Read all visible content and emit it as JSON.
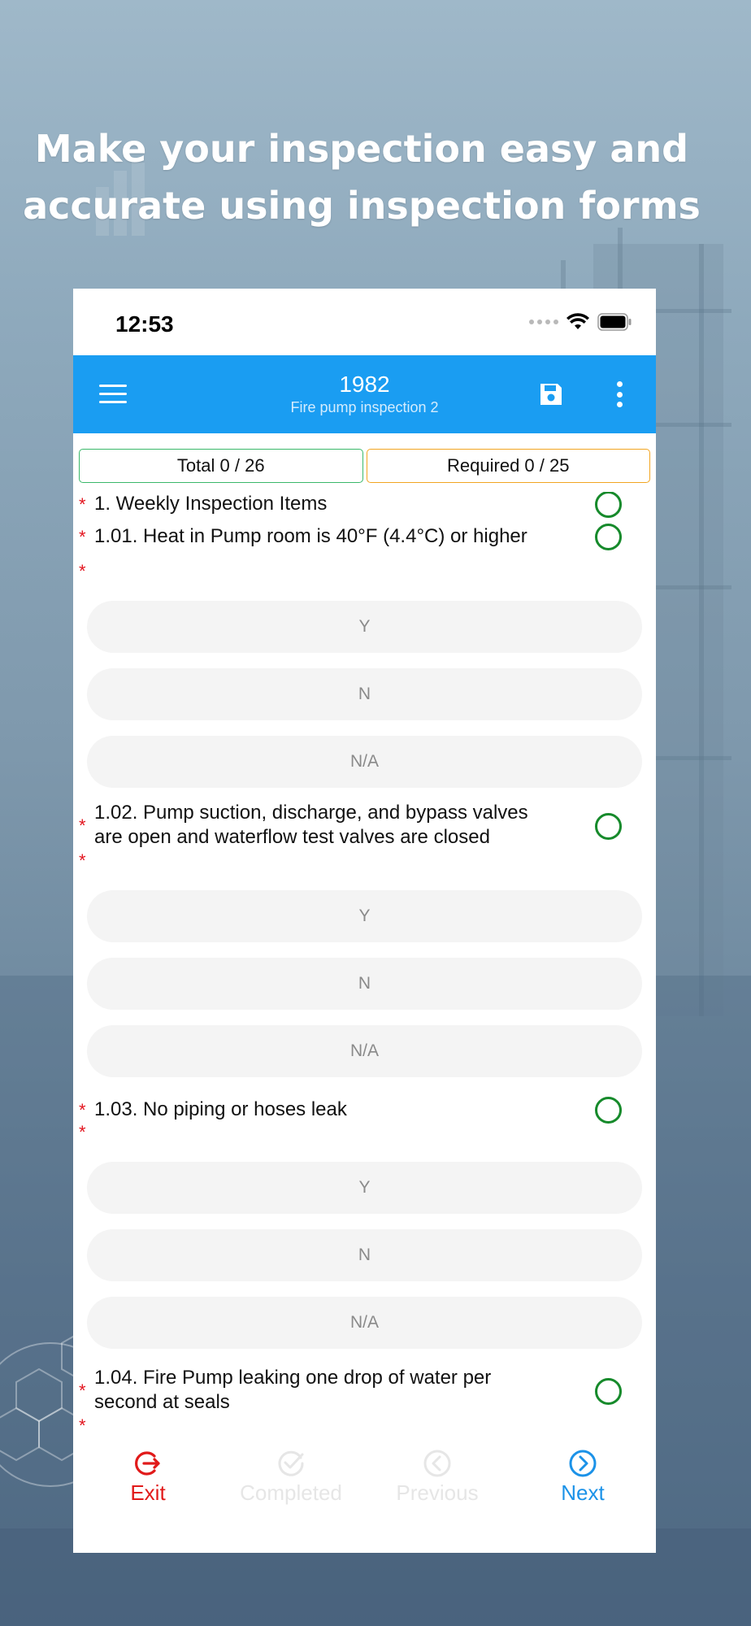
{
  "headline": {
    "line1": "Make your inspection easy and",
    "line2": "accurate using inspection forms"
  },
  "status_bar": {
    "time": "12:53"
  },
  "app_bar": {
    "title": "1982",
    "subtitle": "Fire pump inspection 2",
    "icons": [
      "menu-icon",
      "save-icon",
      "more-vertical-icon"
    ]
  },
  "counters": {
    "total_label": "Total  0 / 26",
    "required_label": "Required  0 / 25"
  },
  "questions": [
    {
      "text": "1. Weekly Inspection Items"
    },
    {
      "text": "1.01. Heat in Pump room is 40°F (4.4°C) or higher"
    },
    {
      "text_line1": "1.02. Pump suction, discharge, and bypass valves",
      "text_line2": "are open and waterflow test valves are closed"
    },
    {
      "text": "1.03. No piping or hoses leak"
    },
    {
      "text_line1": "1.04. Fire Pump leaking one drop of water per",
      "text_line2": "second at seals"
    }
  ],
  "options": [
    "Y",
    "N",
    "N/A"
  ],
  "required_marker": "*",
  "bottom_nav": {
    "exit": "Exit",
    "completed": "Completed",
    "previous": "Previous",
    "next": "Next"
  },
  "colors": {
    "app_bar": "#1a9df2",
    "exit": "#e11a1a",
    "next": "#1b92e8",
    "status_circle": "#168a2b",
    "required_star": "#e3141e",
    "total_border": "#3ab86a",
    "required_border": "#f2a521"
  }
}
